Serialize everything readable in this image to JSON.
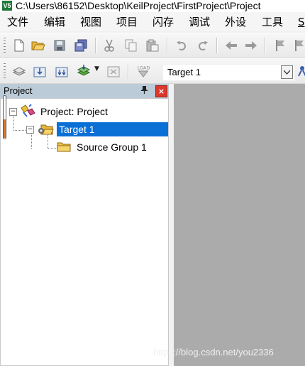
{
  "window": {
    "title": "C:\\Users\\86152\\Desktop\\KeilProject\\FirstProject\\Project",
    "logo_text": "V5"
  },
  "menu": {
    "items": [
      "文件",
      "编辑",
      "视图",
      "项目",
      "闪存",
      "调试",
      "外设",
      "工具",
      "S"
    ]
  },
  "toolbar_build": {
    "target_select_value": "Target 1"
  },
  "project_panel": {
    "title": "Project",
    "pin_symbol": "ᴘ",
    "close_symbol": "×",
    "tree": {
      "root": {
        "label": "Project: Project",
        "expander": "−"
      },
      "target": {
        "label": "Target 1",
        "expander": "−",
        "selected": true
      },
      "group": {
        "label": "Source Group 1"
      }
    }
  },
  "watermark": "https://blog.csdn.net/you2336",
  "colors": {
    "selection": "#0a70d6",
    "panel_header": "#bccbd8",
    "editor_background": "#ababab",
    "close_button": "#d9382d"
  }
}
